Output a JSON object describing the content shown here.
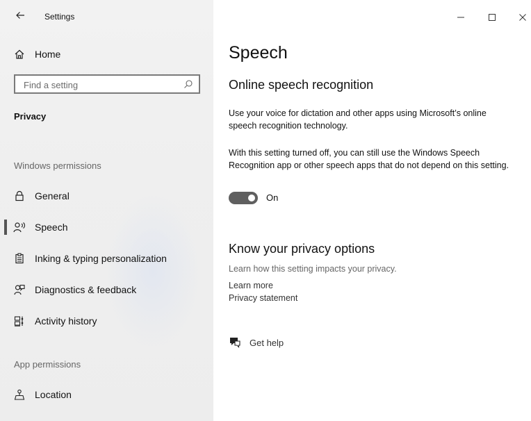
{
  "window": {
    "title": "Settings"
  },
  "sidebar": {
    "home_label": "Home",
    "search_placeholder": "Find a setting",
    "section_title": "Privacy",
    "groups": [
      {
        "label": "Windows permissions",
        "items": [
          {
            "label": "General",
            "icon": "lock-icon",
            "selected": false
          },
          {
            "label": "Speech",
            "icon": "speech-icon",
            "selected": true
          },
          {
            "label": "Inking & typing personalization",
            "icon": "clipboard-icon",
            "selected": false
          },
          {
            "label": "Diagnostics & feedback",
            "icon": "feedback-icon",
            "selected": false
          },
          {
            "label": "Activity history",
            "icon": "timeline-icon",
            "selected": false
          }
        ]
      },
      {
        "label": "App permissions",
        "items": [
          {
            "label": "Location",
            "icon": "location-icon",
            "selected": false
          }
        ]
      }
    ]
  },
  "main": {
    "page_title": "Speech",
    "online_heading": "Online speech recognition",
    "online_desc": "Use your voice for dictation and other apps using Microsoft’s online speech recognition technology.",
    "online_note": "With this setting turned off, you can still use the Windows Speech Recognition app or other speech apps that do not depend on this setting.",
    "toggle_state": "On",
    "privacy_heading": "Know your privacy options",
    "privacy_desc": "Learn how this setting impacts your privacy.",
    "learn_more": "Learn more",
    "privacy_statement": "Privacy statement",
    "get_help": "Get help"
  },
  "colors": {
    "sidebar_bg": "#f0f0f0",
    "toggle_on": "#5f5f5f",
    "selected_bar": "#555555"
  }
}
